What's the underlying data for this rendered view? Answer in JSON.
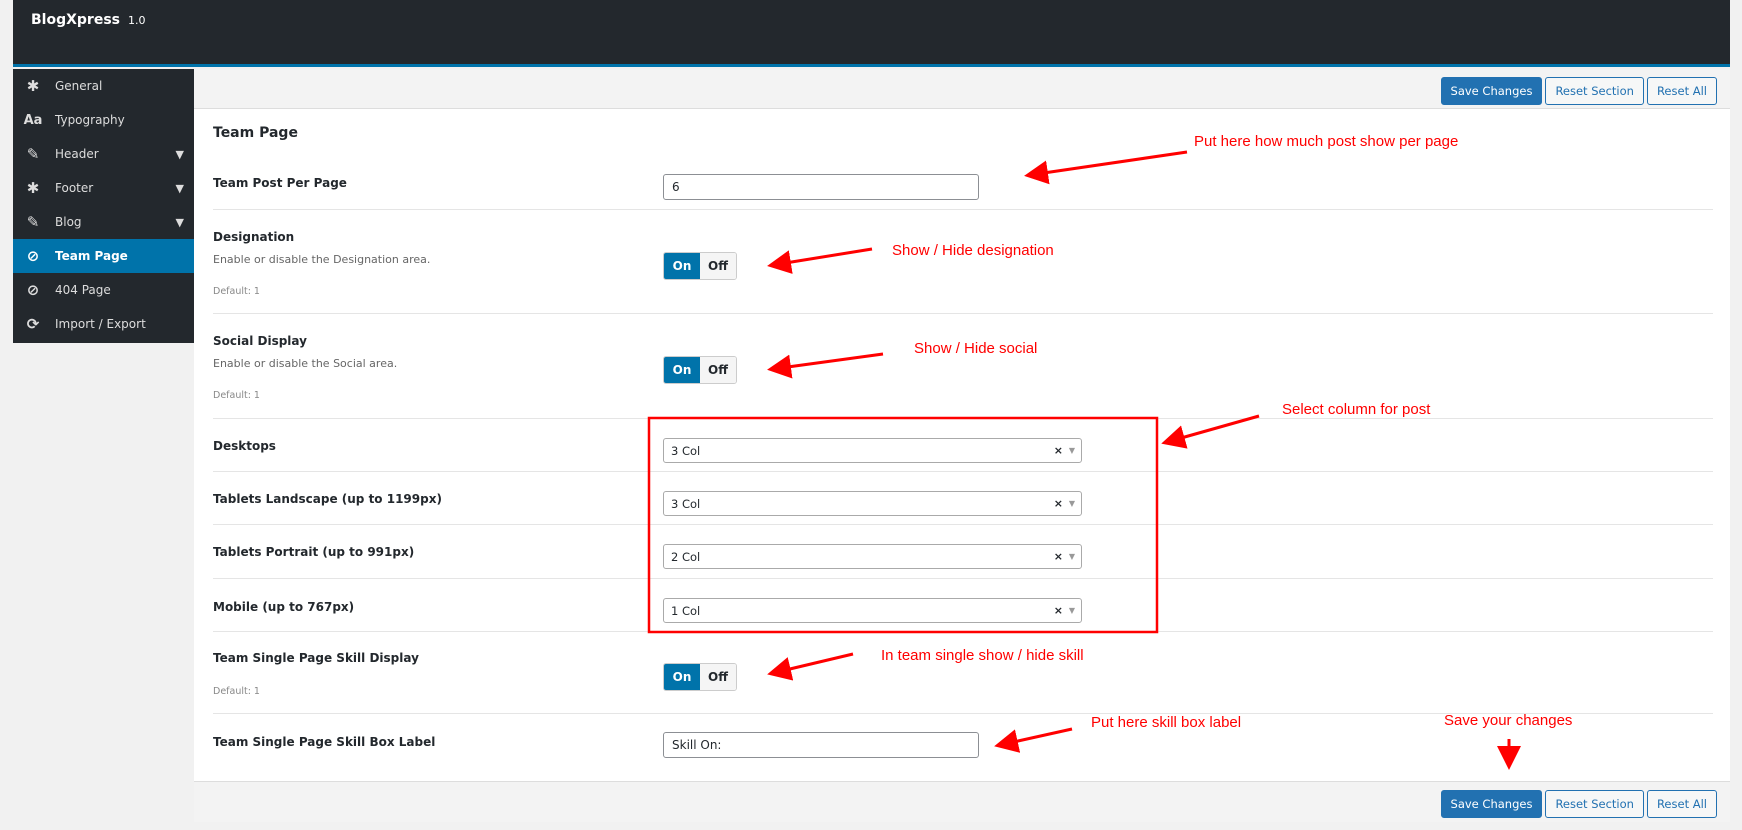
{
  "app": {
    "name": "BlogXpress",
    "version": "1.0"
  },
  "sidebar": {
    "items": [
      {
        "label": "General",
        "icon": "gear-icon",
        "glyph": "✱"
      },
      {
        "label": "Typography",
        "icon": "typography-icon",
        "glyph": "Aa"
      },
      {
        "label": "Header",
        "icon": "edit-icon",
        "glyph": "✎",
        "expandable": true
      },
      {
        "label": "Footer",
        "icon": "gear-icon",
        "glyph": "✱",
        "expandable": true
      },
      {
        "label": "Blog",
        "icon": "edit-icon",
        "glyph": "✎",
        "expandable": true
      },
      {
        "label": "Team Page",
        "icon": "eye-slash-icon",
        "glyph": "⊘",
        "active": true
      },
      {
        "label": "404 Page",
        "icon": "eye-slash-icon",
        "glyph": "⊘"
      },
      {
        "label": "Import / Export",
        "icon": "refresh-icon",
        "glyph": "⟳"
      }
    ],
    "chevron": "⌄"
  },
  "toolbar": {
    "save": "Save Changes",
    "reset_section": "Reset Section",
    "reset_all": "Reset All"
  },
  "section": {
    "title": "Team Page"
  },
  "fields": {
    "post_per_page": {
      "label": "Team Post Per Page",
      "value": "6"
    },
    "designation": {
      "label": "Designation",
      "desc": "Enable or disable the Designation area.",
      "default": "Default: 1",
      "on": "On",
      "off": "Off",
      "state": "on"
    },
    "social": {
      "label": "Social Display",
      "desc": "Enable or disable the Social area.",
      "default": "Default: 1",
      "on": "On",
      "off": "Off",
      "state": "on"
    },
    "desktops": {
      "label": "Desktops",
      "value": "3 Col"
    },
    "tablets_landscape": {
      "label": "Tablets Landscape (up to 1199px)",
      "value": "3 Col"
    },
    "tablets_portrait": {
      "label": "Tablets Portrait (up to 991px)",
      "value": "2 Col"
    },
    "mobile": {
      "label": "Mobile (up to 767px)",
      "value": "1 Col"
    },
    "skill_display": {
      "label": "Team Single Page Skill Display",
      "default": "Default: 1",
      "on": "On",
      "off": "Off",
      "state": "on"
    },
    "skill_label": {
      "label": "Team Single Page Skill Box Label",
      "value": "Skill On:"
    }
  },
  "select_clear": "×",
  "select_arrow": "▼",
  "annotations": {
    "color": "#ff0000",
    "post_per_page": "Put here how much post show per page",
    "designation": "Show / Hide designation",
    "social": "Show / Hide social",
    "columns": "Select column for post",
    "skill": "In team single show / hide skill",
    "skill_label": "Put here skill box label",
    "save": "Save your changes"
  }
}
